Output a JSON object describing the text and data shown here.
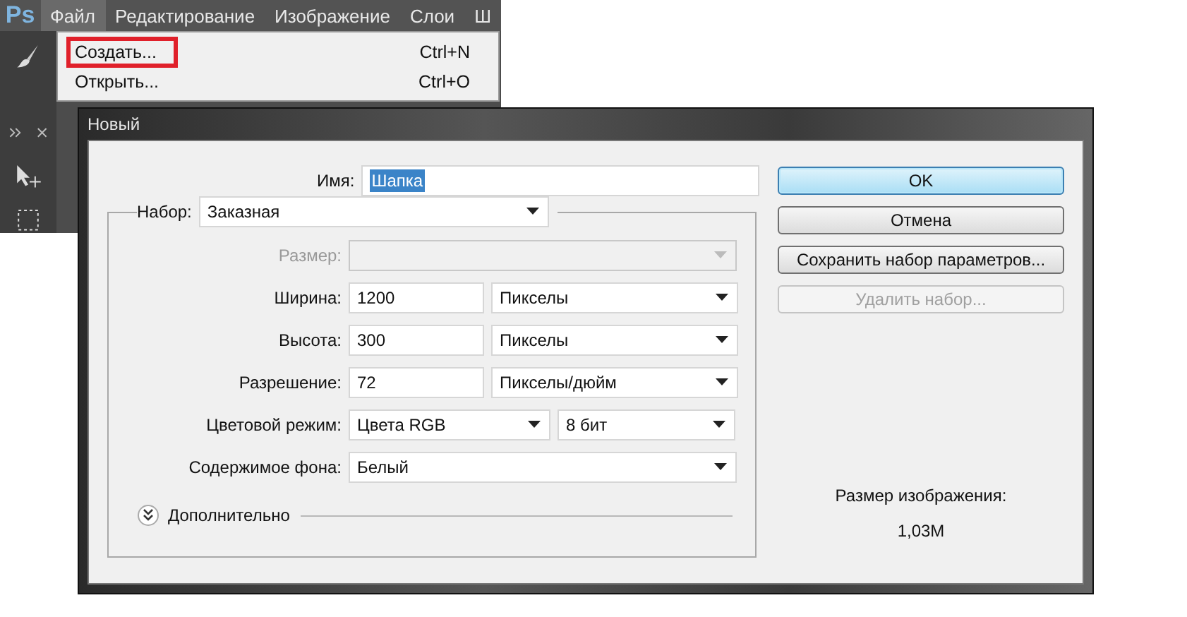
{
  "app": {
    "logo": "Ps",
    "menu": [
      {
        "label": "Файл",
        "selected": true
      },
      {
        "label": "Редактирование",
        "selected": false
      },
      {
        "label": "Изображение",
        "selected": false
      },
      {
        "label": "Слои",
        "selected": false
      },
      {
        "label": "Ш",
        "selected": false
      }
    ],
    "file_menu": [
      {
        "label": "Создать...",
        "shortcut": "Ctrl+N",
        "annotated": true
      },
      {
        "label": "Открыть...",
        "shortcut": "Ctrl+O",
        "annotated": false
      }
    ]
  },
  "dialog": {
    "title": "Новый",
    "name": {
      "label": "Имя:",
      "value": "Шапка",
      "selected": true
    },
    "preset": {
      "label": "Набор:",
      "value": "Заказная"
    },
    "rows": [
      {
        "kind": "dropdown",
        "label": "Размер:",
        "disabled": true
      },
      {
        "kind": "number",
        "label": "Ширина:",
        "value": "1200",
        "unit": "Пикселы"
      },
      {
        "kind": "number",
        "label": "Высота:",
        "value": "300",
        "unit": "Пикселы"
      },
      {
        "kind": "number",
        "label": "Разрешение:",
        "value": "72",
        "unit": "Пикселы/дюйм"
      },
      {
        "kind": "pair",
        "label": "Цветовой режим:",
        "value": "Цвета RGB",
        "unit": "8 бит"
      },
      {
        "kind": "dropdown",
        "label": "Содержимое фона:",
        "value": "Белый",
        "disabled": false
      }
    ],
    "advanced": {
      "label": "Дополнительно",
      "expanded": false
    },
    "buttons": [
      {
        "label": "OK",
        "default": true,
        "disabled": false
      },
      {
        "label": "Отмена",
        "default": false,
        "disabled": false
      },
      {
        "label": "Сохранить набор параметров...",
        "default": false,
        "disabled": false
      },
      {
        "label": "Удалить набор...",
        "default": false,
        "disabled": true
      }
    ],
    "image_size": {
      "label": "Размер изображения:",
      "value": "1,03M"
    }
  }
}
